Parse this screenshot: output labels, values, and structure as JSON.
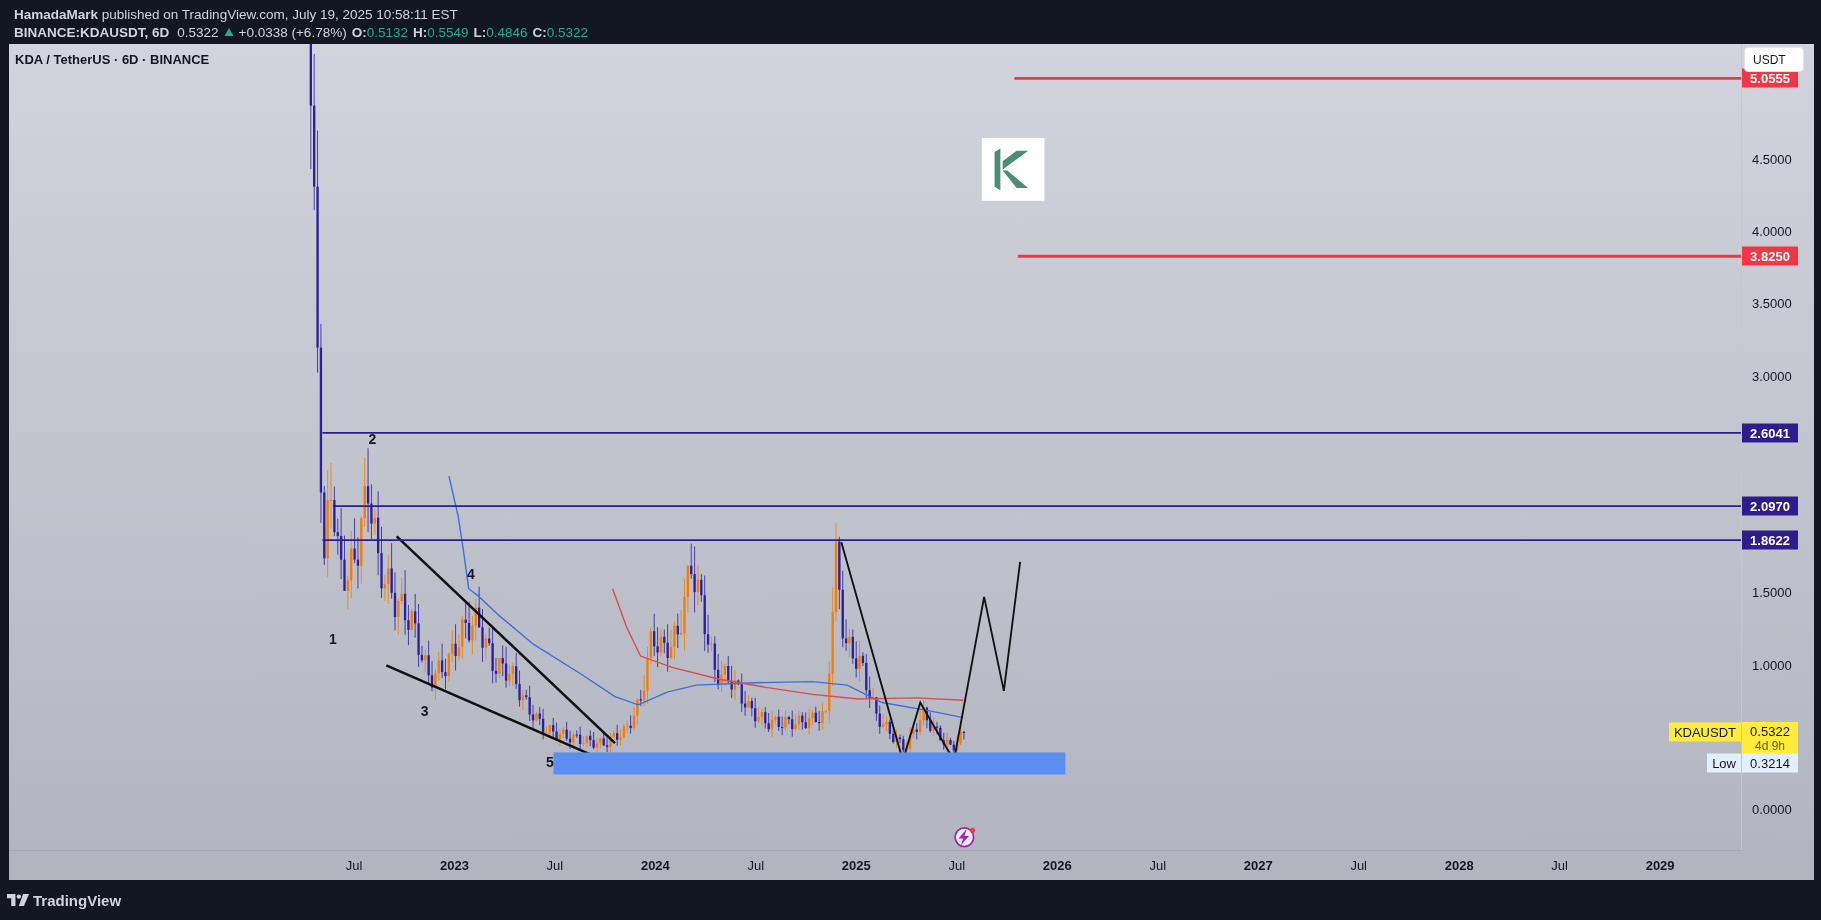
{
  "header": {
    "author": "HamadaMark",
    "published": "published on TradingView.com, July 19, 2025 10:58:11 EST"
  },
  "symbol_line": {
    "symbol": "BINANCE:KDAUSDT, 6D",
    "price": "0.5322",
    "change": "+0.0338 (+6.78%)",
    "ohlc": [
      {
        "label": "O:",
        "value": "0.5132"
      },
      {
        "label": "H:",
        "value": "0.5549"
      },
      {
        "label": "L:",
        "value": "0.4846"
      },
      {
        "label": "C:",
        "value": "0.5322"
      }
    ]
  },
  "legend": {
    "title": "KDA / TetherUS · 6D · BINANCE"
  },
  "price_axis": {
    "unit_button": "USDT",
    "ticks": [
      "4.5000",
      "4.0000",
      "3.5000",
      "3.0000",
      "1.5000",
      "1.0000",
      "0.0000"
    ]
  },
  "levels": [
    {
      "value": "5.0555",
      "color": "#f23645"
    },
    {
      "value": "3.8250",
      "color": "#f23645"
    },
    {
      "value": "2.6041",
      "color": "#2e1c8f"
    },
    {
      "value": "2.0970",
      "color": "#2e1c8f"
    },
    {
      "value": "1.8622",
      "color": "#2e1c8f"
    }
  ],
  "wave_labels": [
    "1",
    "2",
    "3",
    "4",
    "5"
  ],
  "price_tag": {
    "symbol": "KDAUSDT",
    "price": "0.5322",
    "countdown": "4d 9h"
  },
  "low_tag": {
    "label": "Low",
    "value": "0.3214"
  },
  "time_axis": [
    {
      "label": "Jul",
      "kind": "month"
    },
    {
      "label": "2023",
      "kind": "year"
    },
    {
      "label": "Jul",
      "kind": "month"
    },
    {
      "label": "2024",
      "kind": "year"
    },
    {
      "label": "Jul",
      "kind": "month"
    },
    {
      "label": "2025",
      "kind": "year"
    },
    {
      "label": "Jul",
      "kind": "month"
    },
    {
      "label": "2026",
      "kind": "year"
    },
    {
      "label": "Jul",
      "kind": "month"
    },
    {
      "label": "2027",
      "kind": "year"
    },
    {
      "label": "Jul",
      "kind": "month"
    },
    {
      "label": "2028",
      "kind": "year"
    },
    {
      "label": "Jul",
      "kind": "month"
    },
    {
      "label": "2029",
      "kind": "year"
    }
  ],
  "footer": {
    "brand": "TradingView"
  }
}
